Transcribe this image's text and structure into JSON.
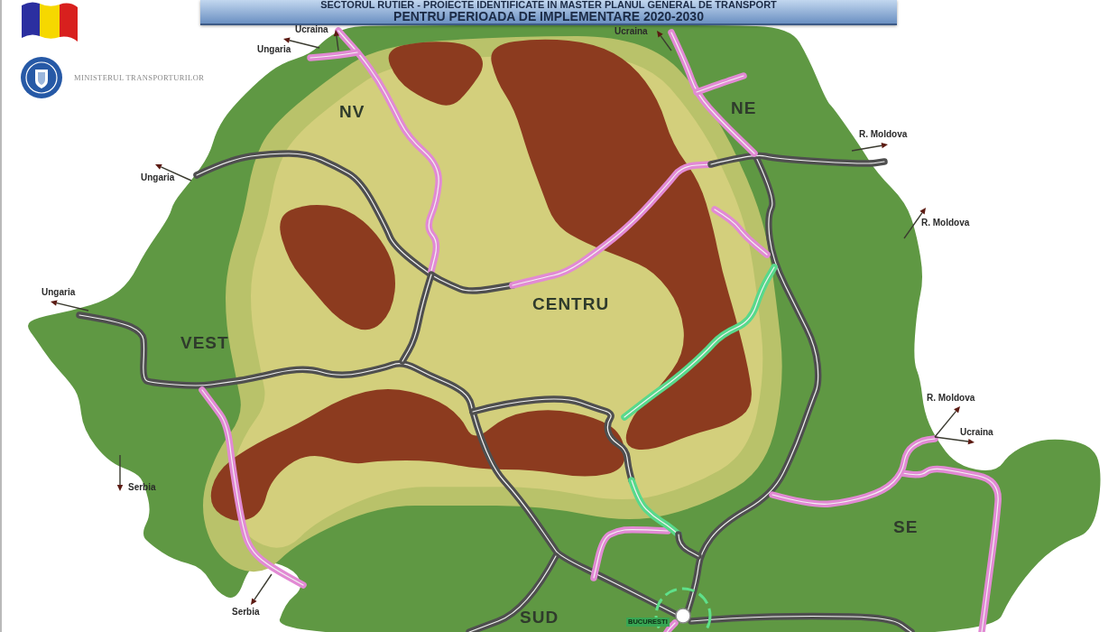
{
  "header": {
    "title_lines": [
      "SECTORUL RUTIER - PROIECTE IDENTIFICATE IN MASTER PLANUL GENERAL DE TRANSPORT",
      "PENTRU PERIOADA DE IMPLEMENTARE 2020-2030"
    ],
    "ministry": "MINISTERUL TRANSPORTURILOR"
  },
  "map": {
    "borders": [
      {
        "label": "Ucraina"
      },
      {
        "label": "Ungaria"
      },
      {
        "label": "Ucraina"
      },
      {
        "label": "R. Moldova"
      },
      {
        "label": "Ungaria"
      },
      {
        "label": "R. Moldova"
      },
      {
        "label": "Ungaria"
      },
      {
        "label": "R. Moldova"
      },
      {
        "label": "Ucraina"
      },
      {
        "label": "Serbia"
      },
      {
        "label": "Serbia"
      }
    ],
    "regions": [
      {
        "label": "NV"
      },
      {
        "label": "NE"
      },
      {
        "label": "CENTRU"
      },
      {
        "label": "VEST"
      },
      {
        "label": "SE"
      },
      {
        "label": "SUD"
      }
    ],
    "capital": {
      "label": "BUCURESTI"
    },
    "routes": [
      {
        "color": "#4f4f4f"
      },
      {
        "color": "#4f4f4f"
      },
      {
        "color": "#e28ad4"
      },
      {
        "color": "#4f4f4f"
      },
      {
        "color": "#4f4f4f"
      },
      {
        "color": "#4f4f4f"
      },
      {
        "color": "#4f4f4f"
      },
      {
        "color": "#4f4f4f"
      },
      {
        "color": "#4f4f4f"
      },
      {
        "color": "#58d98c"
      },
      {
        "color": "#4f4f4f"
      },
      {
        "color": "#4f4f4f"
      },
      {
        "color": "#e28ad4"
      },
      {
        "color": "#e28ad4"
      },
      {
        "color": "#e28ad4"
      },
      {
        "color": "#e28ad4"
      },
      {
        "color": "#e28ad4"
      },
      {
        "color": "#e28ad4"
      },
      {
        "color": "#e28ad4"
      },
      {
        "color": "#e28ad4"
      },
      {
        "color": "#e28ad4"
      },
      {
        "color": "#e28ad4"
      },
      {
        "color": "#58d98c"
      }
    ]
  }
}
